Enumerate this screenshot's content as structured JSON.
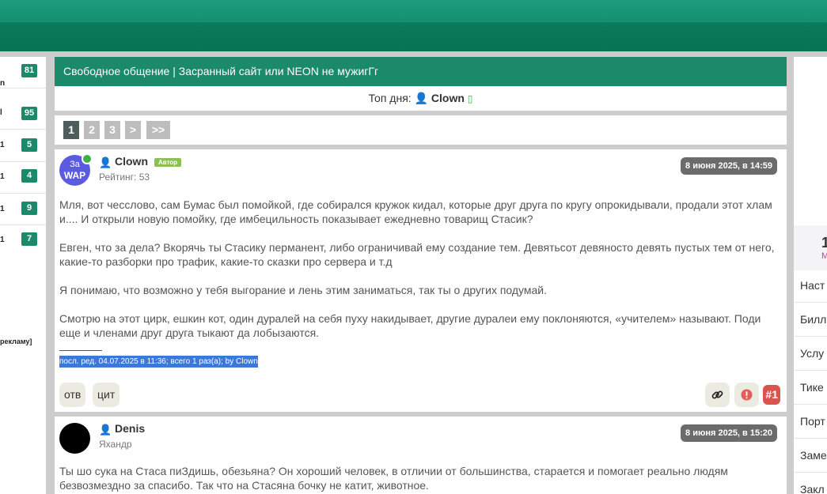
{
  "sidebar": {
    "items": [
      {
        "text": "n",
        "count": "81"
      },
      {
        "text": "l",
        "count": "95"
      },
      {
        "text": "1",
        "count": "5"
      },
      {
        "text": "1",
        "count": "4"
      },
      {
        "text": "1",
        "count": "9"
      },
      {
        "text": "1",
        "count": "7"
      }
    ],
    "ad_text": "рекламу]"
  },
  "topic": {
    "title": "Свободное общение | Засранный сайт или NEON не мужигГг",
    "top_day_label": "Топ дня:",
    "top_day_user": "Clown"
  },
  "pagination": {
    "pages": [
      "1",
      "2",
      "3",
      ">",
      ">>"
    ],
    "current": "1"
  },
  "posts": [
    {
      "user": "Clown",
      "avatar_text": "За",
      "avatar_text2": "WAP",
      "badge": "Автор",
      "rank": "Рейтинг: 53",
      "date": "8 июня 2025, в 14:59",
      "paragraphs": [
        "Мля, вот чесслово, сам Бумас был помойкой, где собирался кружок кидал, которые друг друга по кругу опрокидывали, продали этот хлам и.... И открыли новую помойку, где имбецильность показывает ежедневно товарищ Стасик?",
        "Евген, что за дела? Вкорячь ты Стасику перманент, либо ограничивай ему создание тем. Девятьсот девяносто девять пустых тем от него, какие-то разборки про трафик, какие-то сказки про сервера и т.д",
        "Я понимаю, что возможно у тебя выгорание и лень этим заниматься, так ты о других подумай.",
        "Смотрю на этот цирк, ешкин кот, один дуралей на себя пуху накидывает, другие дуралеи ему поклоняются, «учителем» называют. Поди еще и членами друг друга тыкают да лобызаются."
      ],
      "edit_note": "посл. ред. 04.07.2025 в 11:36; всего 1 раз(а); by Clown",
      "reply_label": "отв",
      "quote_label": "цит",
      "post_number": "#1"
    },
    {
      "user": "Denis",
      "rank": "Яхандр",
      "date": "8 июня 2025, в 15:20",
      "paragraphs": [
        "Ты шо сука на Стаса пиЗдишь, обезьяна? Он хороший человек, в отличии от большинства, старается и помогает реально людям безвозмездно за спасибо. Так что на Стасяна бочку не катит, животное."
      ]
    }
  ],
  "right_panel": {
    "count": "1",
    "count_sub": "M",
    "items": [
      "Наст",
      "Билл",
      "Услу",
      "Тике",
      "Порт",
      "Заме",
      "Закл"
    ]
  },
  "colors": {
    "brand": "#1a8a6a",
    "pager_current": "#4e5d5b",
    "badge_author": "#8cc152",
    "post_number": "#d9534f"
  }
}
